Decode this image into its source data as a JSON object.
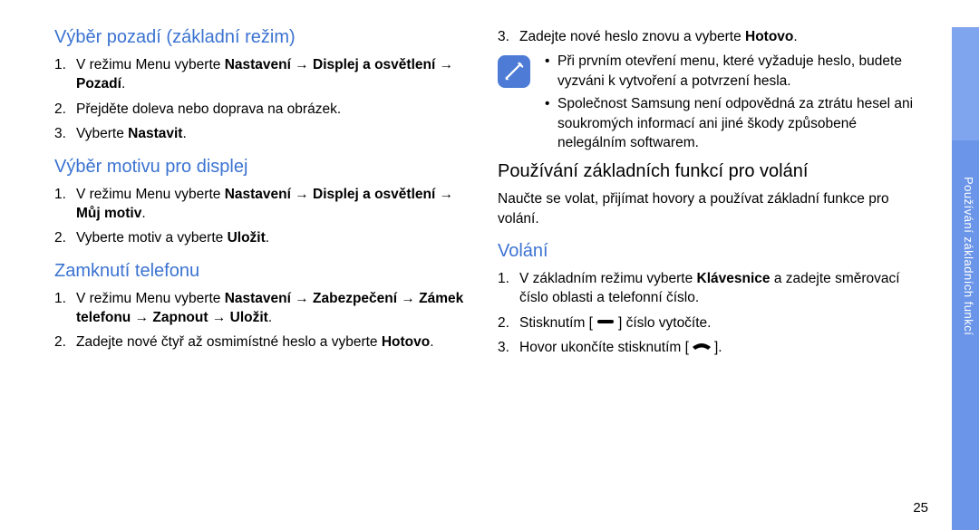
{
  "left": {
    "h1": "Výběr pozadí (základní režim)",
    "list1": {
      "i1_pre": "V režimu Menu vyberte ",
      "i1_bold": "Nastavení → Displej a osvětlení → Pozadí",
      "i1_post": ".",
      "i2": "Přejděte doleva nebo doprava na obrázek.",
      "i3_pre": "Vyberte ",
      "i3_bold": "Nastavit",
      "i3_post": "."
    },
    "h2": "Výběr motivu pro displej",
    "list2": {
      "i1_pre": "V režimu Menu vyberte ",
      "i1_bold": "Nastavení → Displej a osvětlení → Můj motiv",
      "i1_post": ".",
      "i2_pre": "Vyberte motiv a vyberte ",
      "i2_bold": "Uložit",
      "i2_post": "."
    },
    "h3": "Zamknutí telefonu",
    "list3": {
      "i1_pre": "V režimu Menu vyberte ",
      "i1_bold": "Nastavení → Zabezpečení → Zámek telefonu → Zapnout → Uložit",
      "i1_post": ".",
      "i2_pre": "Zadejte nové čtyř až osmimístné heslo a vyberte ",
      "i2_bold": "Hotovo",
      "i2_post": "."
    }
  },
  "right": {
    "list_top": {
      "i3_pre": "Zadejte nové heslo znovu a vyberte ",
      "i3_bold": "Hotovo",
      "i3_post": "."
    },
    "note": {
      "b1": "Při prvním otevření menu, které vyžaduje heslo, budete vyzváni k vytvoření a potvrzení hesla.",
      "b2": "Společnost Samsung není odpovědná za ztrátu hesel ani soukromých informací ani jiné škody způsobené nelegálním softwarem."
    },
    "h1": "Používání základních funkcí pro volání",
    "p1": "Naučte se volat, přijímat hovory a používat základní funkce pro volání.",
    "h2": "Volání",
    "list_call": {
      "i1_pre": "V základním režimu vyberte ",
      "i1_bold": "Klávesnice",
      "i1_post": " a zadejte směrovací číslo oblasti a telefonní číslo.",
      "i2_pre": "Stisknutím [",
      "i2_post": "] číslo vytočíte.",
      "i3_pre": "Hovor ukončíte stisknutím [",
      "i3_post": "]."
    }
  },
  "side_label": "Používání základních funkcí",
  "page_number": "25"
}
